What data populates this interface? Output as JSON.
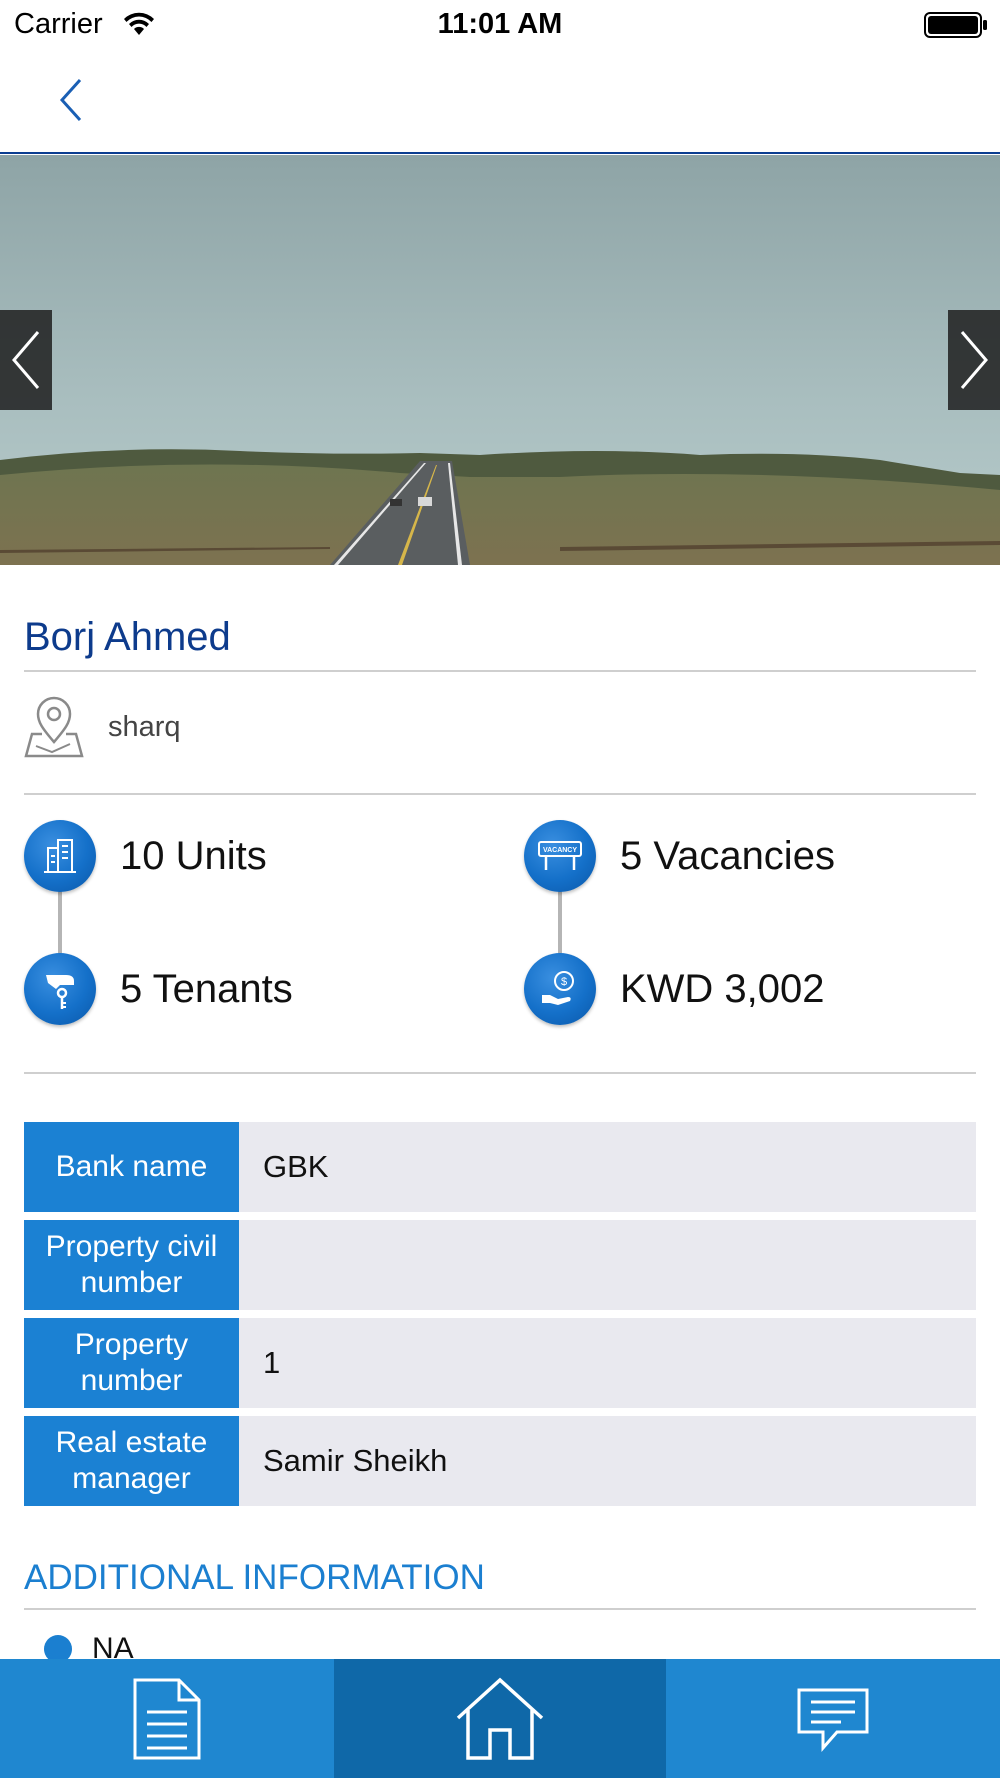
{
  "status_bar": {
    "carrier": "Carrier",
    "time": "11:01 AM"
  },
  "nav": {
    "back_icon": "chevron-left-icon"
  },
  "hero": {
    "prev_icon": "chevron-left-icon",
    "next_icon": "chevron-right-icon"
  },
  "property": {
    "name": "Borj Ahmed",
    "location": "sharq"
  },
  "stats": {
    "units": "10 Units",
    "vacancies": "5 Vacancies",
    "tenants": "5 Tenants",
    "amount": "KWD 3,002",
    "vacancy_sign_text": "VACANCY"
  },
  "info": {
    "rows": [
      {
        "key": "Bank name",
        "value": "GBK"
      },
      {
        "key": "Property civil number",
        "value": ""
      },
      {
        "key": "Property number",
        "value": "1"
      },
      {
        "key": "Real estate manager",
        "value": "Samir Sheikh"
      }
    ]
  },
  "additional": {
    "title": "ADDITIONAL INFORMATION",
    "items": [
      "NA"
    ]
  },
  "tabs": [
    {
      "icon": "document-icon",
      "active": false
    },
    {
      "icon": "home-icon",
      "active": true
    },
    {
      "icon": "chat-icon",
      "active": false
    }
  ],
  "colors": {
    "primary": "#1b81d3",
    "title": "#0d3b8c",
    "tab_active": "#0f68a8"
  }
}
